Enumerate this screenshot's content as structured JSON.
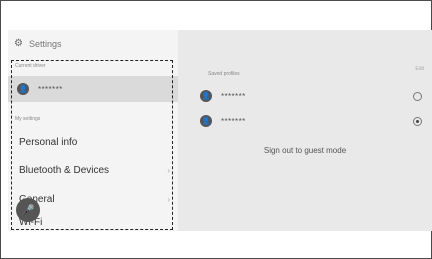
{
  "header": {
    "title": "Settings",
    "icon": "gear-icon"
  },
  "left": {
    "current_driver_label": "Current driver",
    "driver_name": "*******",
    "my_settings_label": "My settings",
    "menu": [
      {
        "label": "Personal info",
        "chevron": ""
      },
      {
        "label": "Bluetooth & Devices",
        "chevron": "›"
      },
      {
        "label": "General",
        "chevron": "›"
      },
      {
        "label": "Wi-Fi",
        "chevron": ""
      }
    ],
    "mic_icon": "microphone-icon"
  },
  "right": {
    "saved_profiles_label": "Saved profiles",
    "edit_label": "Edit",
    "profiles": [
      {
        "name": "*******",
        "selected": false
      },
      {
        "name": "*******",
        "selected": true
      }
    ],
    "guest_label": "Sign out to guest mode"
  },
  "colors": {
    "accent": "#555555",
    "panel_left": "#f4f4f4",
    "panel_right": "#e9e9e9",
    "highlight_row": "#dadada"
  }
}
